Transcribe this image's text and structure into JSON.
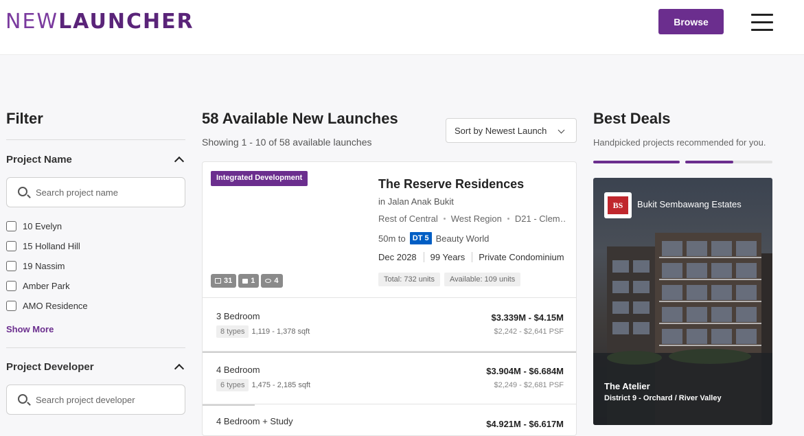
{
  "header": {
    "logo": {
      "part1": "NEW",
      "part2": "LAUNCHER"
    },
    "browse_label": "Browse"
  },
  "filter": {
    "title": "Filter",
    "project_name": {
      "title": "Project Name",
      "placeholder": "Search project name",
      "options": [
        "10 Evelyn",
        "15 Holland Hill",
        "19 Nassim",
        "Amber Park",
        "AMO Residence"
      ],
      "show_more": "Show More"
    },
    "project_developer": {
      "title": "Project Developer",
      "placeholder": "Search project developer"
    }
  },
  "main": {
    "title": "58 Available New Launches",
    "subtitle": "Showing 1 - 10 of 58 available launches",
    "sort_label": "Sort by Newest Launch",
    "listing": {
      "badge": "Integrated Development",
      "media": {
        "photos": "31",
        "videos": "1",
        "tours": "4"
      },
      "name": "The Reserve Residences",
      "location": "in Jalan Anak Bukit",
      "region": [
        "Rest of Central",
        "West Region",
        "D21 - Clem…"
      ],
      "mrt": {
        "distance": "50m to",
        "line": "DT 5",
        "poi": "Beauty World"
      },
      "meta": [
        "Dec 2028",
        "99 Years",
        "Private Condominium"
      ],
      "units": {
        "total": "Total: 732 units",
        "available": "Available: 109 units"
      },
      "unit_types": [
        {
          "bed": "3 Bedroom",
          "types": "8 types",
          "size": "1,119 - 1,378 sqft",
          "price": "$3.339M - $4.15M",
          "psf": "$2,242 - $2,641 PSF",
          "bar_pct": 100
        },
        {
          "bed": "4 Bedroom",
          "types": "6 types",
          "size": "1,475 - 2,185 sqft",
          "price": "$3.904M - $6.684M",
          "psf": "$2,249 - $2,681 PSF",
          "bar_pct": 14
        },
        {
          "bed": "4 Bedroom + Study",
          "types": "",
          "size": "",
          "price": "$4.921M - $6.617M",
          "psf": "",
          "bar_pct": 0
        }
      ]
    }
  },
  "deals": {
    "title": "Best Deals",
    "subtitle": "Handpicked projects recommended for you.",
    "progress_pct": 55,
    "accent": "#6b2e8e",
    "card": {
      "developer": "Bukit Sembawang Estates",
      "developer_logo": "BS",
      "name": "The Atelier",
      "location": "District 9 - Orchard / River Valley"
    }
  },
  "colors": {
    "brand": "#6b2e8e",
    "mrt_dt": "#005ec4"
  }
}
